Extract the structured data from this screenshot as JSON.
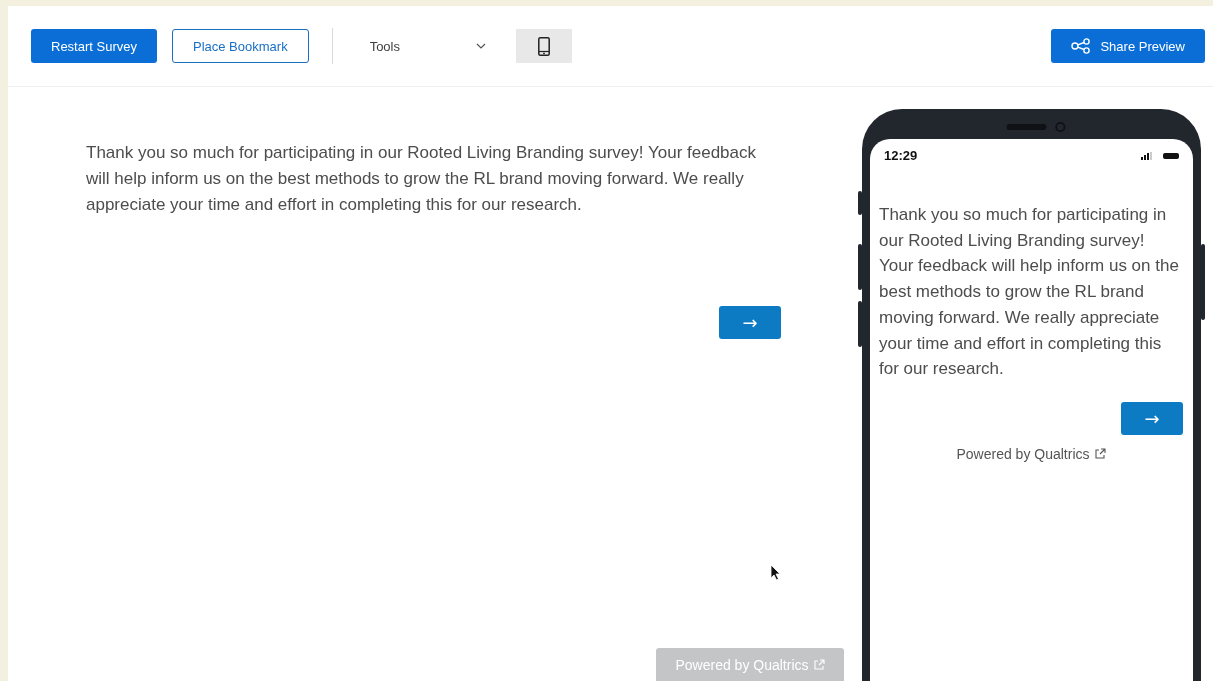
{
  "toolbar": {
    "restart_button": "Restart Survey",
    "bookmark_button": "Place Bookmark",
    "tools_dropdown": "Tools",
    "mobile_view_toggle": {
      "selected": true
    },
    "share_button": "Share Preview"
  },
  "survey": {
    "message": "Thank you so much for participating in our Rooted Living Branding survey! Your feedback will help inform us on the best methods to grow the RL brand moving forward. We really appreciate your time and effort in completing this for our research.",
    "next_button": "→",
    "powered_by": "Powered by Qualtrics"
  },
  "phone": {
    "time": "12:29",
    "message": "Thank you so much for participating in our Rooted Living Branding survey! Your feedback will help inform us on the best methods to grow the RL brand moving forward. We really appreciate your time and effort in completing this for our research.",
    "next_button": "→",
    "powered_by": "Powered by Qualtrics"
  }
}
